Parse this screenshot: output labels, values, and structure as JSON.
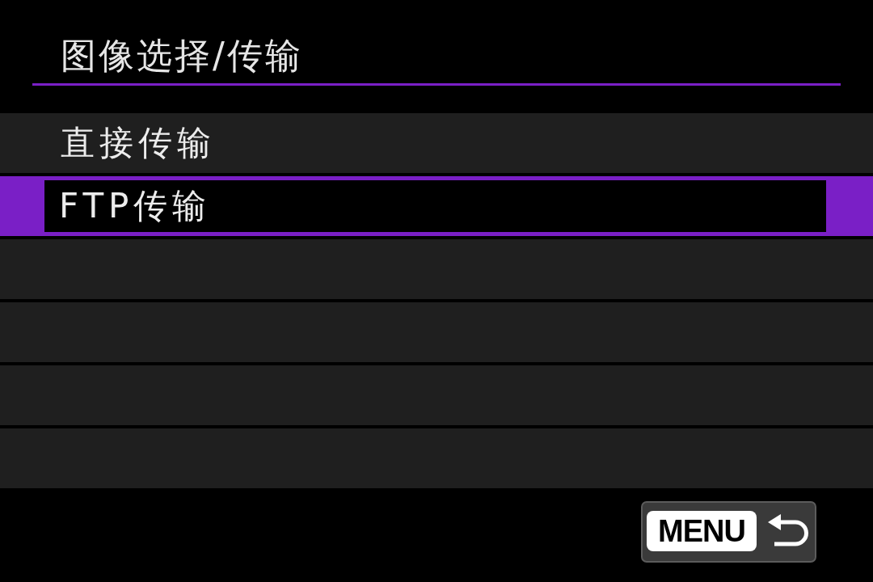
{
  "title": "图像选择/传输",
  "menu_items": [
    {
      "label": "直接传输",
      "selected": false
    },
    {
      "label": "FTP传输",
      "selected": true
    }
  ],
  "back_button": {
    "label": "MENU"
  }
}
